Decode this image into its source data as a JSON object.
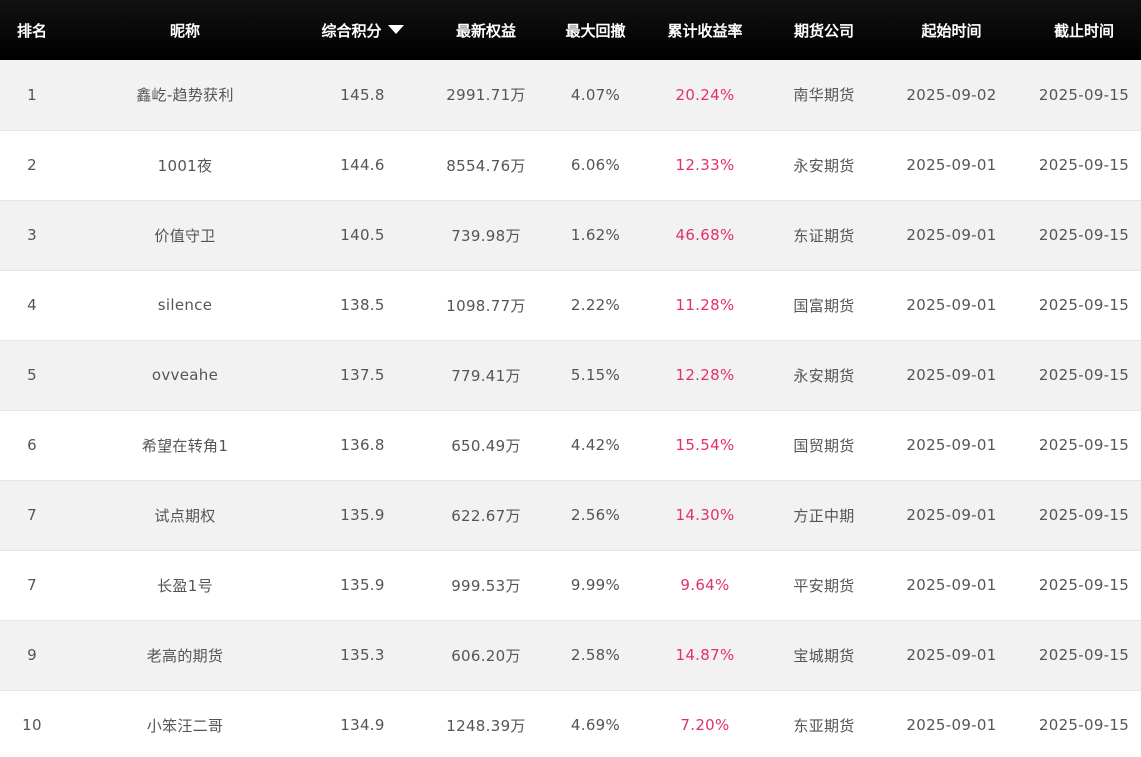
{
  "table": {
    "headers": {
      "rank": "排名",
      "nickname": "昵称",
      "score": "综合积分",
      "equity": "最新权益",
      "drawdown": "最大回撤",
      "return": "累计收益率",
      "company": "期货公司",
      "start": "起始时间",
      "end": "截止时间"
    },
    "sort_icon": "sort-desc-triangle",
    "accent_color": "#e0306f",
    "rows": [
      {
        "rank": "1",
        "nickname": "鑫屹-趋势获利",
        "score": "145.8",
        "equity": "2991.71万",
        "drawdown": "4.07%",
        "return": "20.24%",
        "company": "南华期货",
        "start": "2025-09-02",
        "end": "2025-09-15"
      },
      {
        "rank": "2",
        "nickname": "1001夜",
        "score": "144.6",
        "equity": "8554.76万",
        "drawdown": "6.06%",
        "return": "12.33%",
        "company": "永安期货",
        "start": "2025-09-01",
        "end": "2025-09-15"
      },
      {
        "rank": "3",
        "nickname": "价值守卫",
        "score": "140.5",
        "equity": "739.98万",
        "drawdown": "1.62%",
        "return": "46.68%",
        "company": "东证期货",
        "start": "2025-09-01",
        "end": "2025-09-15"
      },
      {
        "rank": "4",
        "nickname": "silence",
        "score": "138.5",
        "equity": "1098.77万",
        "drawdown": "2.22%",
        "return": "11.28%",
        "company": "国富期货",
        "start": "2025-09-01",
        "end": "2025-09-15"
      },
      {
        "rank": "5",
        "nickname": "ovveahe",
        "score": "137.5",
        "equity": "779.41万",
        "drawdown": "5.15%",
        "return": "12.28%",
        "company": "永安期货",
        "start": "2025-09-01",
        "end": "2025-09-15"
      },
      {
        "rank": "6",
        "nickname": "希望在转角1",
        "score": "136.8",
        "equity": "650.49万",
        "drawdown": "4.42%",
        "return": "15.54%",
        "company": "国贸期货",
        "start": "2025-09-01",
        "end": "2025-09-15"
      },
      {
        "rank": "7",
        "nickname": "试点期权",
        "score": "135.9",
        "equity": "622.67万",
        "drawdown": "2.56%",
        "return": "14.30%",
        "company": "方正中期",
        "start": "2025-09-01",
        "end": "2025-09-15"
      },
      {
        "rank": "7",
        "nickname": "长盈1号",
        "score": "135.9",
        "equity": "999.53万",
        "drawdown": "9.99%",
        "return": "9.64%",
        "company": "平安期货",
        "start": "2025-09-01",
        "end": "2025-09-15"
      },
      {
        "rank": "9",
        "nickname": "老高的期货",
        "score": "135.3",
        "equity": "606.20万",
        "drawdown": "2.58%",
        "return": "14.87%",
        "company": "宝城期货",
        "start": "2025-09-01",
        "end": "2025-09-15"
      },
      {
        "rank": "10",
        "nickname": "小笨汪二哥",
        "score": "134.9",
        "equity": "1248.39万",
        "drawdown": "4.69%",
        "return": "7.20%",
        "company": "东亚期货",
        "start": "2025-09-01",
        "end": "2025-09-15"
      }
    ]
  }
}
